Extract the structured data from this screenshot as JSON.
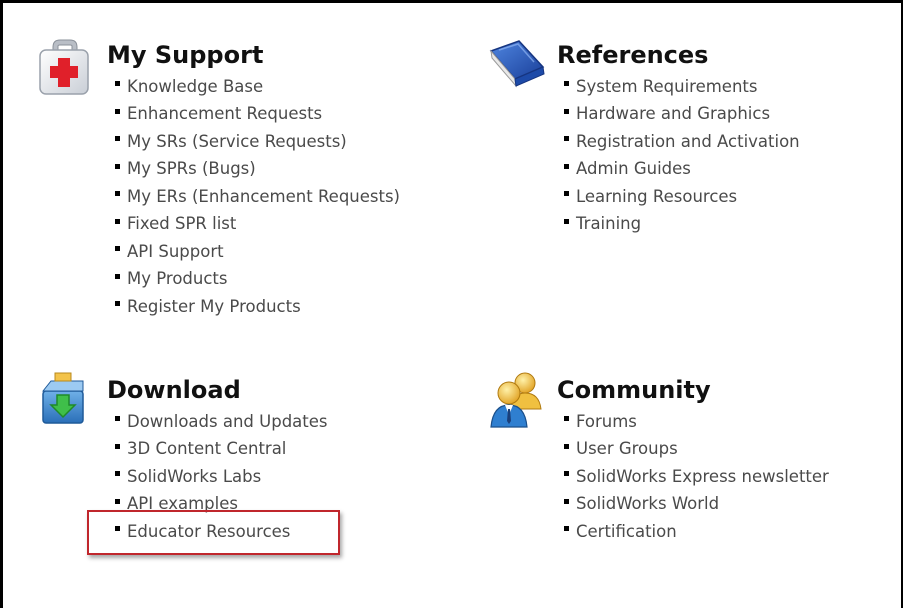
{
  "sections": {
    "my_support": {
      "title": "My Support",
      "icon": "first-aid-kit-icon",
      "links": [
        "Knowledge Base",
        "Enhancement Requests",
        "My SRs (Service Requests)",
        "My SPRs (Bugs)",
        "My ERs (Enhancement Requests)",
        "Fixed SPR list",
        "API Support",
        "My Products",
        "Register My Products"
      ]
    },
    "references": {
      "title": "References",
      "icon": "book-icon",
      "links": [
        "System Requirements",
        "Hardware and Graphics",
        "Registration and Activation",
        "Admin Guides",
        "Learning Resources",
        "Training"
      ]
    },
    "download": {
      "title": "Download",
      "icon": "download-box-icon",
      "links": [
        "Downloads and Updates",
        "3D Content Central",
        "SolidWorks Labs",
        "API examples",
        "Educator Resources"
      ]
    },
    "community": {
      "title": "Community",
      "icon": "users-icon",
      "links": [
        "Forums",
        "User Groups",
        "SolidWorks Express newsletter",
        "SolidWorks World",
        "Certification"
      ]
    }
  },
  "highlight": {
    "target": "Educator Resources",
    "color": "#c0262c"
  }
}
